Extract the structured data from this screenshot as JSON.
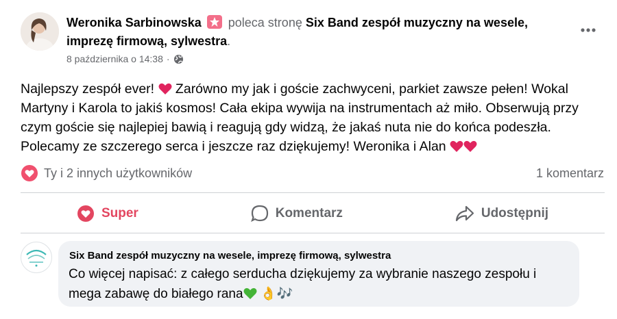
{
  "author": {
    "name": "Weronika Sarbinowska",
    "action_text": "poleca stronę",
    "page_name": "Six Band zespół muzyczny na wesele, imprezę firmową, sylwestra",
    "period": "."
  },
  "meta": {
    "date": "8 października o 14:38",
    "separator": "·"
  },
  "post": {
    "text_part1": "Najlepszy zespół ever! ",
    "text_part2": " Zarówno my jak i goście zachwyceni, parkiet zawsze pełen! Wokal Martyny i Karola to jakiś kosmos! Cała ekipa wywija na instrumentach aż miło. Obserwują przy czym goście się najlepiej bawią i reagują gdy widzą, że jakaś nuta nie do końca podeszła. Polecamy ze szczerego serca i jeszcze raz dziękujemy! Weronika i Alan "
  },
  "reactions": {
    "label": "Ty i 2 innych użytkowników",
    "comment_count": "1 komentarz"
  },
  "actions": {
    "react_label": "Super",
    "comment_label": "Komentarz",
    "share_label": "Udostępnij"
  },
  "comment": {
    "author": "Six Band zespół muzyczny na wesele, imprezę firmową, sylwestra",
    "text": "Co więcej napisać: z całego serducha dziękujemy za wybranie naszego zespołu i mega zabawę do białego rana",
    "emojis": "👌🎶"
  },
  "colors": {
    "text_primary": "#050505",
    "text_secondary": "#65676b",
    "love_red": "#e34660",
    "heart_red": "#e0245e",
    "bubble_bg": "#f0f2f5",
    "divider": "#ced0d4"
  }
}
